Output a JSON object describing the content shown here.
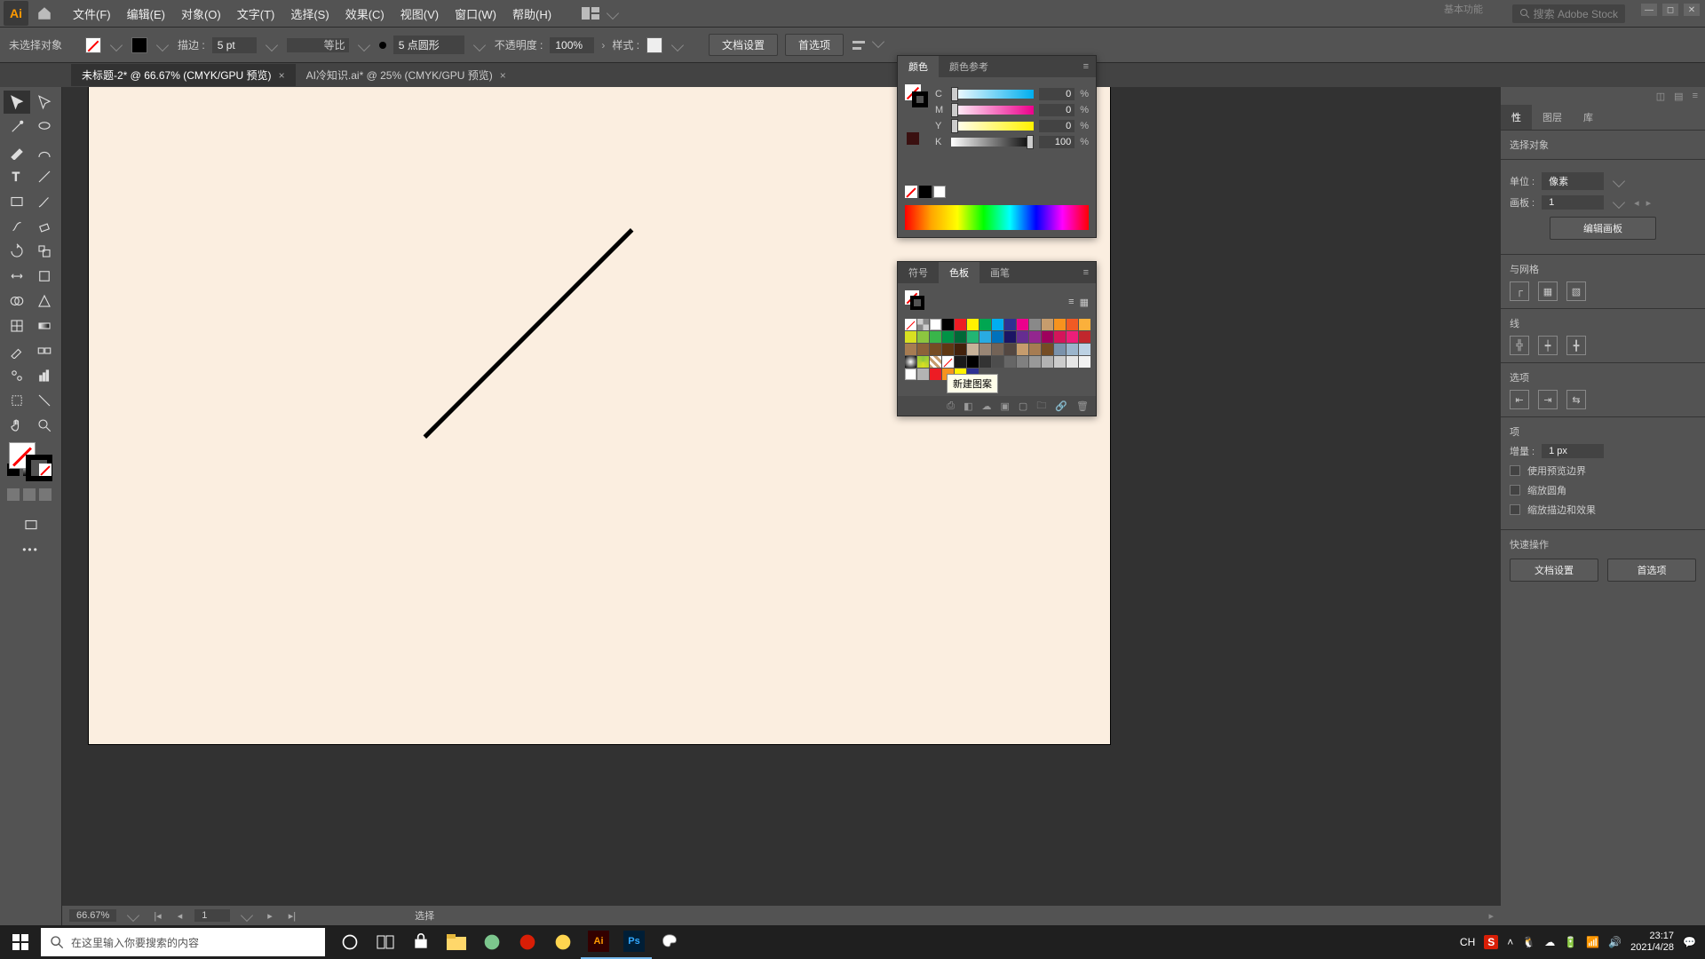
{
  "app": {
    "logo_text": "Ai"
  },
  "menu": {
    "file": "文件(F)",
    "edit": "编辑(E)",
    "object": "对象(O)",
    "type": "文字(T)",
    "select": "选择(S)",
    "effect": "效果(C)",
    "view": "视图(V)",
    "window": "窗口(W)",
    "help": "帮助(H)",
    "essentials": "基本功能"
  },
  "search_stock_placeholder": "搜索 Adobe Stock",
  "control": {
    "selection_label": "未选择对象",
    "stroke_label": "描边 :",
    "stroke_value": "5 pt",
    "stroke_profile": "等比",
    "brush_label": "5 点圆形",
    "opacity_label": "不透明度 :",
    "opacity_value": "100%",
    "style_label": "样式 :",
    "doc_setup": "文档设置",
    "prefs": "首选项"
  },
  "tabs": {
    "active": "未标题-2* @ 66.67% (CMYK/GPU 预览)",
    "inactive": "AI冷知识.ai* @ 25% (CMYK/GPU 预览)"
  },
  "status": {
    "zoom": "66.67%",
    "page": "1",
    "tool": "选择"
  },
  "right": {
    "tab_prop": "性",
    "tab_layers": "图层",
    "tab_lib": "库",
    "no_sel": "选择对象",
    "units_label": "单位 :",
    "units_value": "像素",
    "artboard_label": "画板 :",
    "artboard_value": "1",
    "edit_artboard": "编辑画板",
    "sect_grid": "与网格",
    "sect_guide": "线",
    "sect_options": "选项",
    "sect_opts_inner": "项",
    "inc_label": "增量 :",
    "inc_value": "1 px",
    "use_preview": "使用预览边界",
    "scale_corners": "缩放圆角",
    "scale_strokes": "缩放描边和效果",
    "quick_label": "快速操作",
    "doc_setup": "文档设置",
    "prefs": "首选项"
  },
  "color_panel": {
    "color_tab": "颜色",
    "guide_tab": "颜色参考",
    "c_label": "C",
    "c_val": "0",
    "m_label": "M",
    "m_val": "0",
    "y_label": "Y",
    "y_val": "0",
    "k_label": "K",
    "k_val": "100",
    "pct": "%"
  },
  "swatch_panel": {
    "sym_tab": "符号",
    "sw_tab": "色板",
    "br_tab": "画笔",
    "tooltip": "新建图案"
  },
  "taskbar": {
    "search_placeholder": "在这里输入你要搜索的内容",
    "ime": "CH",
    "time": "23:17",
    "date": "2021/4/28"
  }
}
